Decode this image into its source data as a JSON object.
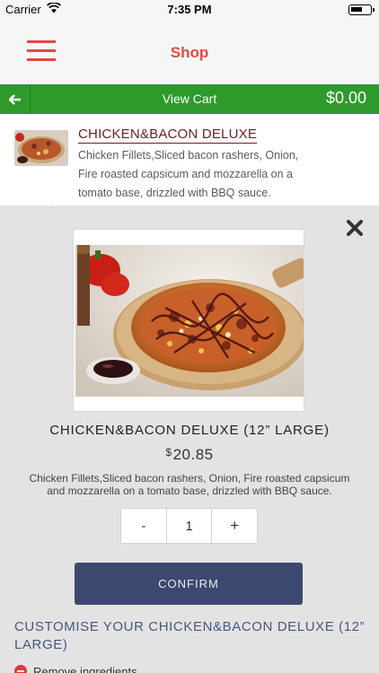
{
  "status_bar": {
    "carrier": "Carrier",
    "time": "7:35 PM"
  },
  "nav": {
    "title": "Shop",
    "menu_icon": "hamburger-menu-icon"
  },
  "cart": {
    "back_icon": "arrow-left-icon",
    "label": "View Cart",
    "total": "$0.00"
  },
  "product_row": {
    "name": "CHICKEN&BACON DELUXE",
    "description": "Chicken Fillets,Sliced bacon rashers, Onion, Fire roasted capsicum and mozzarella on a tomato base, drizzled with BBQ sauce."
  },
  "detail": {
    "close_icon": "close-x-icon",
    "title": "CHICKEN&BACON DELUXE (12” LARGE)",
    "currency": "$",
    "price": "20.85",
    "description": "Chicken Fillets,Sliced bacon rashers, Onion, Fire roasted capsicum and mozzarella on a tomato base, drizzled with BBQ sauce.",
    "qty_minus": "-",
    "quantity": "1",
    "qty_plus": "+",
    "confirm_label": "CONFIRM",
    "customise_title": "CUSTOMISE YOUR CHICKEN&BACON DELUXE (12” LARGE)",
    "remove_label": "Remove ingredients"
  },
  "colors": {
    "brand_red": "#e04b42",
    "cart_green": "#2d9a2b",
    "confirm_navy": "#3d4870"
  }
}
